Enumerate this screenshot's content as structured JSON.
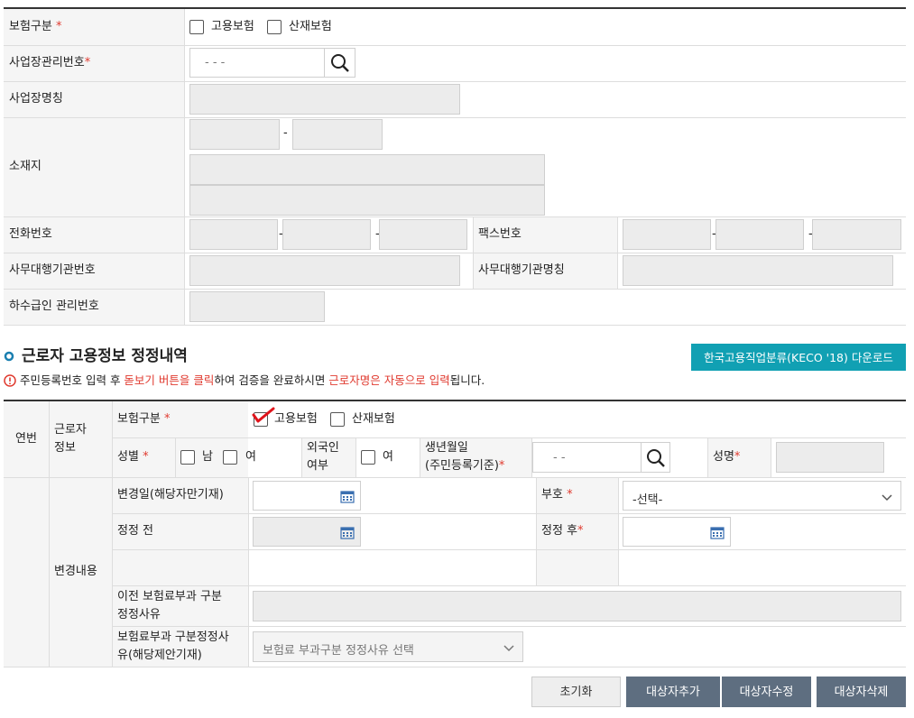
{
  "form1": {
    "insurance_type_label": "보험구분",
    "required_mark": "*",
    "employment_insurance": "고용보험",
    "industrial_insurance": "산재보험",
    "business_no_label": "사업장관리번호",
    "business_no_placeholder": "- -   -",
    "business_name_label": "사업장명칭",
    "address_label": "소재지",
    "dash": "-",
    "phone_label": "전화번호",
    "fax_label": "팩스번호",
    "agent_no_label": "사무대행기관번호",
    "agent_name_label": "사무대행기관명칭",
    "sub_recipient_label": "하수급인 관리번호"
  },
  "section": {
    "title": "근로자 고용정보 정정내역",
    "download_button": "한국고용직업분류(KECO '18) 다운로드",
    "notice_1": "주민등록번호 입력 후 ",
    "notice_2": "돋보기 버튼을 클릭",
    "notice_3": "하여 검증을 완료하시면 ",
    "notice_4": "근로자명은 자동으로 입력",
    "notice_5": "됩니다."
  },
  "form2": {
    "seq_label": "연번",
    "worker_info_label_1": "근로자",
    "worker_info_label_2": "정보",
    "insurance_type_label": "보험구분",
    "employment_insurance": "고용보험",
    "industrial_insurance": "산재보험",
    "gender_label": "성별",
    "male": "남",
    "female": "여",
    "foreigner_label_1": "외국인",
    "foreigner_label_2": "여부",
    "foreigner_yes": "여",
    "birth_label_1": "생년월일",
    "birth_label_2": "(주민등록기준)",
    "birth_placeholder": "- -",
    "name_label": "성명",
    "change_content_label": "변경내용",
    "change_date_label": "변경일(해당자만기재)",
    "sign_label": "부호",
    "sign_select": "-선택-",
    "before_label": "정정 전",
    "after_label": "정정 후",
    "prev_reason_label_1": "이전 보험료부과 구분",
    "prev_reason_label_2": "정정사유",
    "reason_label_1": "보험료부과 구분정정사",
    "reason_label_2": "유(해당제안기재)",
    "reason_select": "보험료 부과구분 정정사유 선택"
  },
  "buttons": {
    "reset": "초기화",
    "add": "대상자추가",
    "edit": "대상자수정",
    "delete": "대상자삭제"
  },
  "colors": {
    "accent": "#11a0b3",
    "dark_button": "#5e6e80",
    "required": "#e03a2f",
    "title_bullet": "#1a7fb0"
  }
}
